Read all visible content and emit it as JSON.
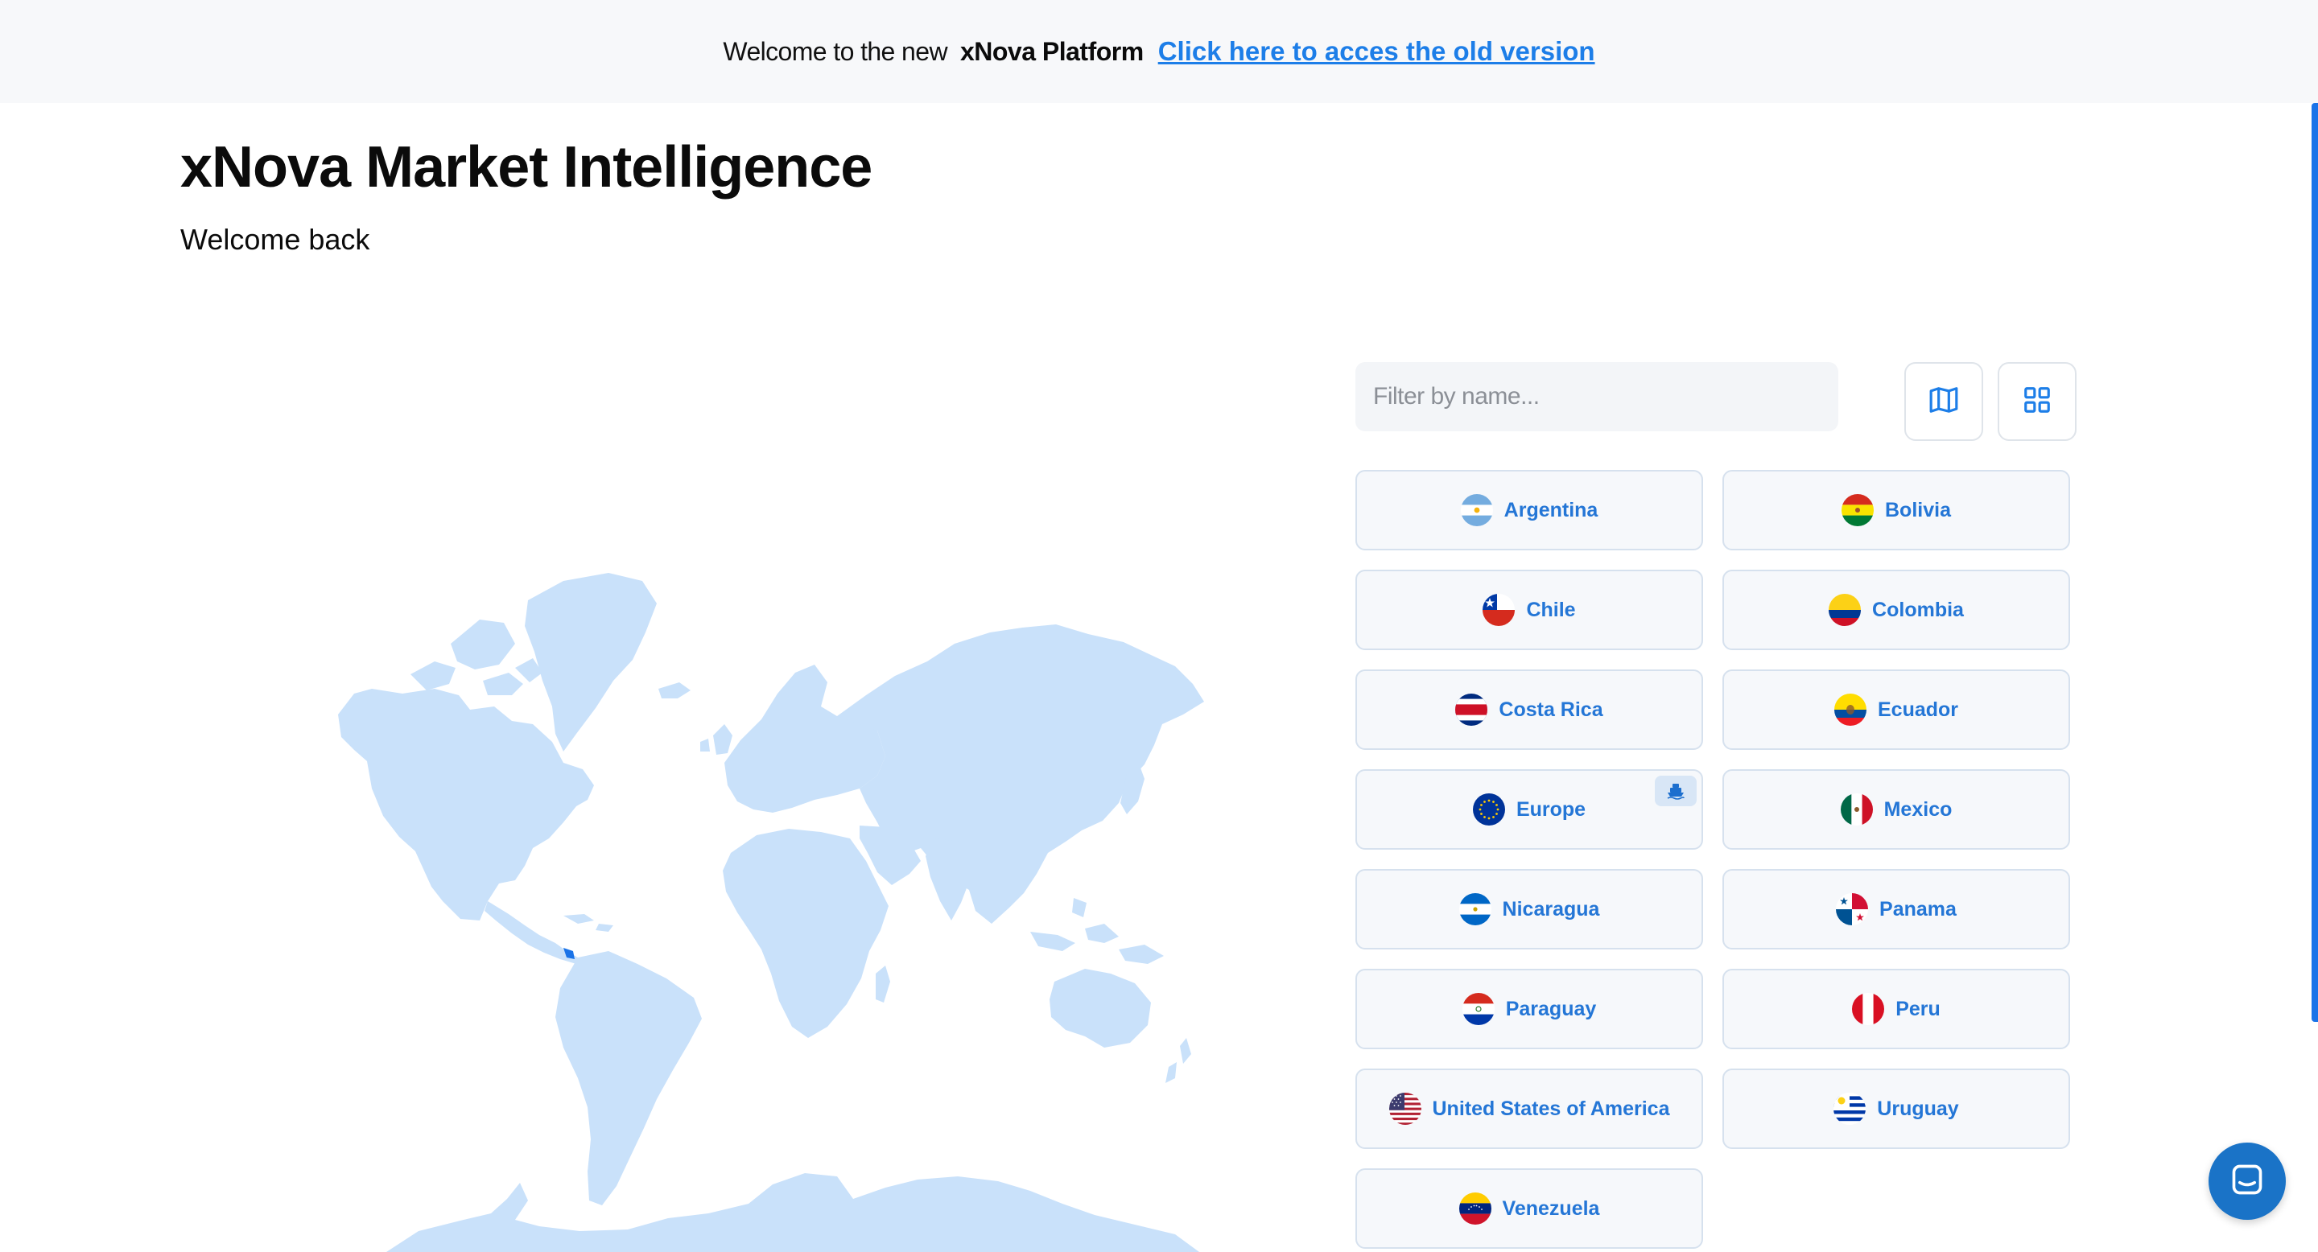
{
  "banner": {
    "welcome_text": "Welcome to the new",
    "brand": "xNova Platform",
    "old_version_link": "Click here to acces the old version"
  },
  "header": {
    "title": "xNova Market Intelligence",
    "subtitle": "Welcome back"
  },
  "filter": {
    "placeholder": "Filter by name..."
  },
  "view_toggle": {
    "map_icon": "map-icon",
    "grid_icon": "grid-icon"
  },
  "colors": {
    "accent": "#1d7ee8",
    "country_label": "#2476d6",
    "map_land": "#c9e1fa",
    "map_highlight": "#1a73e8",
    "button_bg": "#f6f8fb",
    "button_border": "#d6e1ee",
    "chat_button": "#1a73c7"
  },
  "countries": [
    {
      "label": "Argentina",
      "flag_icon": "argentina-flag-icon"
    },
    {
      "label": "Bolivia",
      "flag_icon": "bolivia-flag-icon"
    },
    {
      "label": "Chile",
      "flag_icon": "chile-flag-icon"
    },
    {
      "label": "Colombia",
      "flag_icon": "colombia-flag-icon"
    },
    {
      "label": "Costa Rica",
      "flag_icon": "costa-rica-flag-icon"
    },
    {
      "label": "Ecuador",
      "flag_icon": "ecuador-flag-icon"
    },
    {
      "label": "Europe",
      "flag_icon": "europe-flag-icon",
      "badge_icon": "ship-icon"
    },
    {
      "label": "Mexico",
      "flag_icon": "mexico-flag-icon"
    },
    {
      "label": "Nicaragua",
      "flag_icon": "nicaragua-flag-icon"
    },
    {
      "label": "Panama",
      "flag_icon": "panama-flag-icon"
    },
    {
      "label": "Paraguay",
      "flag_icon": "paraguay-flag-icon"
    },
    {
      "label": "Peru",
      "flag_icon": "peru-flag-icon"
    },
    {
      "label": "United States of America",
      "flag_icon": "usa-flag-icon"
    },
    {
      "label": "Uruguay",
      "flag_icon": "uruguay-flag-icon"
    },
    {
      "label": "Venezuela",
      "flag_icon": "venezuela-flag-icon"
    }
  ],
  "chat": {
    "icon": "chat-icon"
  }
}
